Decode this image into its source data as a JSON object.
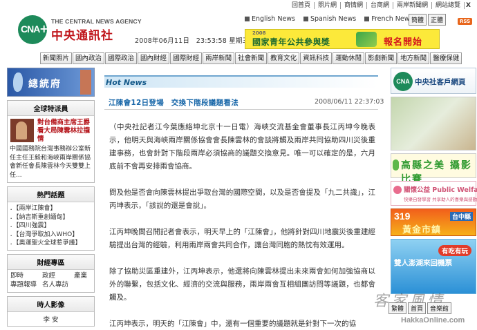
{
  "toplinks": [
    "回首頁",
    "照片網",
    "商情網",
    "台商網",
    "兩岸新聞網",
    "網站總覽"
  ],
  "toplinks_close": "X",
  "brand": {
    "logo_text": "CNA",
    "name_en": "THE CENTRAL NEWS AGENCY",
    "name_cn": "中央通訊社"
  },
  "datetime": "2008年06月11日　23:53:58 星期三",
  "languages": [
    "English News",
    "Spanish News",
    "French News"
  ],
  "lang_switch": [
    "簡體",
    "正體"
  ],
  "rss": "RSS",
  "banner": {
    "year": "2008",
    "title": "國家青年公共參與獎",
    "cta": "報名開始"
  },
  "nav": [
    "新聞照片",
    "國內政治",
    "國際政治",
    "國內財經",
    "國際財經",
    "兩岸新聞",
    "社會新聞",
    "教育文化",
    "資訊科技",
    "運動休閒",
    "影劇新聞",
    "地方新聞",
    "醫療保健"
  ],
  "left": {
    "president_banner": "總統府",
    "feature": {
      "header": "全球特派員",
      "headline": "對台備商主席王爵看大局陳雲林拉攏情",
      "desc": "中國國務院台灣事務辦公室新任主任王毅和海峽兩岸關係協會新任會長陳雲林今天雙雙上任..."
    },
    "hot_topics": {
      "header": "熱門話題",
      "items": [
        "．【兩岸江陳會】",
        "．【納吉斯重創緬甸】",
        "．【四川強震】",
        "．【台灣爭取加入WHO】",
        "．【奧運聖火全球惹爭議】"
      ]
    },
    "finance": {
      "header": "財經專區",
      "items": [
        "即時",
        "政經",
        "產業",
        "專題報導",
        "名人專訪"
      ]
    },
    "people": {
      "header": "時人影像",
      "name": "李 安"
    }
  },
  "main": {
    "section_label": "Hot News",
    "title": "江陳會12日登場　交換下階段議題看法",
    "date": "2008/06/11 22:37:03",
    "paragraphs": [
      "（中央社記者江今葉應絡坤北京十一日電）海峽交流基金會董事長江丙坤今晚表示，他明天與海峽兩岸關係協會會長陳雲林的會談將觸及兩岸共同協助四川災後重建事務，也會針對下階段兩岸必須協商的議題交換意見。唯一可以確定的是，六月底前不會再安排兩會協商。",
      "問及他是否會向陳雲林提出爭取台灣的國際空間，以及是否會提及「九二共識」，江丙坤表示，「該說的還是會說」。",
      "江丙坤晚間召開記者會表示，明天早上的「江陳會」，他將針對四川地震災後重建經驗提出台灣的經驗，利用兩岸兩會共同合作，讓台灣同胞的熱忱有效運用。",
      "除了協助災區重建外，江丙坤表示，他還將向陳雲林提出未來兩會如何加強協商以外的聯繫，包括文化、經濟的交流與服務，兩岸兩會互相組團訪問等議題，也都會觸及。",
      "江丙坤表示，明天的「江陳會」中，還有一個重要的議題就是針對下一次的協"
    ]
  },
  "right": {
    "client_label": "中央社客戶網頁",
    "photo_contest": "高縣之美 攝影比賽",
    "welfare": "關懷公益 Public Welfare",
    "welfare_sub": "快樂自發學習 共享助人的喜樂與感動",
    "taichung_num": "319",
    "taichung_county": "台中縣",
    "taichung_market": "黃金市鎮",
    "penghu_tag": "有吃有玩",
    "penghu_text": "雙人澎湖來回機票"
  },
  "bottombar": [
    "繁體",
    "首頁",
    "音樂館"
  ],
  "watermark": "客家風情",
  "watermark_url": "HakkaOnline.com"
}
